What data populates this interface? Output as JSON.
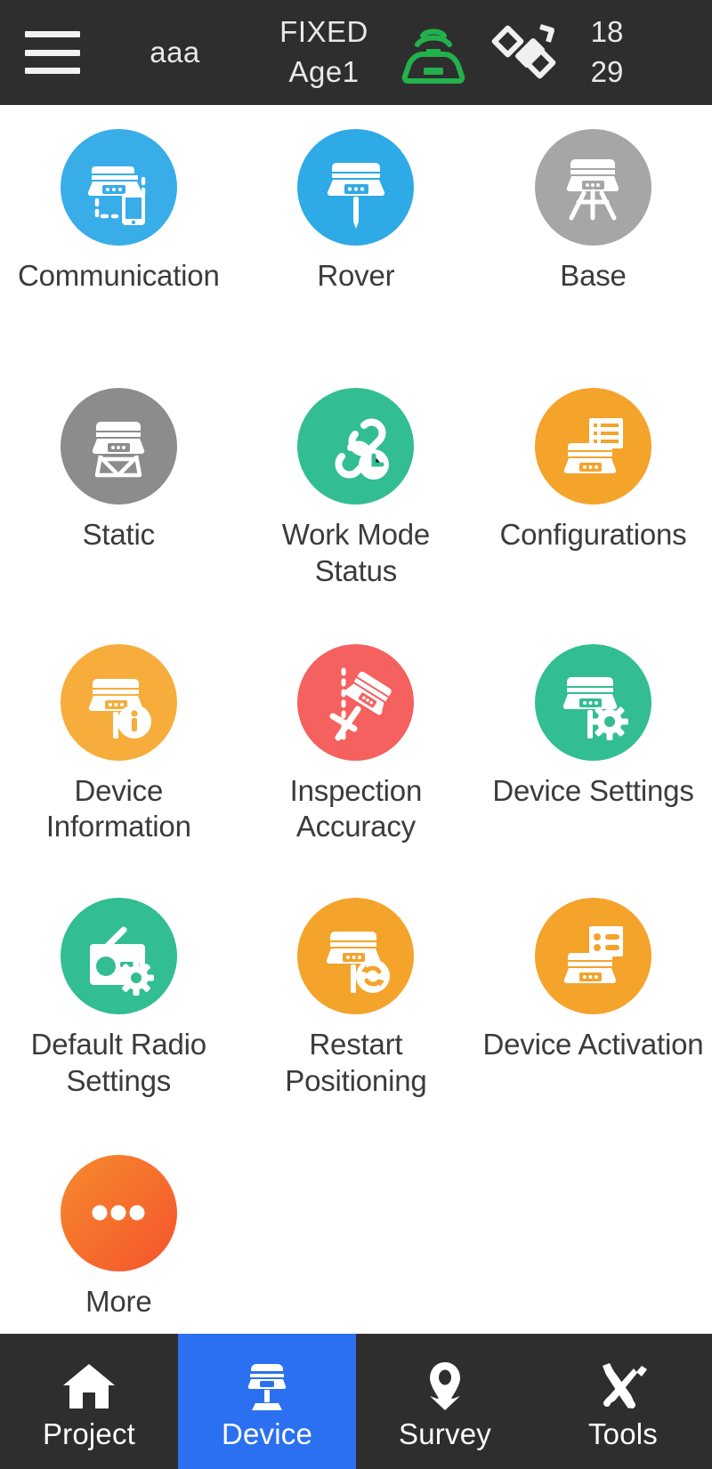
{
  "header": {
    "menu_icon": "hamburger-menu-icon",
    "project_name": "aaa",
    "fix_status": "FIXED",
    "age_status": "Age1",
    "radio_icon": "radio-receiver-signal-icon",
    "satellite_icon": "satellite-icon",
    "satellites_used": "18",
    "satellites_tracked": "29",
    "bar_color": "#2e2e2e",
    "radio_icon_color": "#22b14c"
  },
  "main": {
    "items": [
      {
        "label": "Communication",
        "icon": "receiver-to-phone-link-icon",
        "color": "#38ade8"
      },
      {
        "label": "Rover",
        "icon": "receiver-on-pole-icon",
        "color": "#2eaae6"
      },
      {
        "label": "Base",
        "icon": "receiver-on-tripod-icon",
        "color": "#a6a6a6"
      },
      {
        "label": "Static",
        "icon": "receiver-static-mount-icon",
        "color": "#8c8c8c"
      },
      {
        "label": "Work Mode Status",
        "icon": "link-clock-icon",
        "color": "#32bd93"
      },
      {
        "label": "Configurations",
        "icon": "receiver-list-icon",
        "color": "#f4a32b"
      },
      {
        "label": "Device Information",
        "icon": "receiver-info-icon",
        "color": "#f6ad3c"
      },
      {
        "label": "Inspection Accuracy",
        "icon": "tilted-pole-accuracy-icon",
        "color": "#f4615f"
      },
      {
        "label": "Device Settings",
        "icon": "receiver-gear-icon",
        "color": "#32bd93"
      },
      {
        "label": "Default Radio Settings",
        "icon": "radio-gear-icon",
        "color": "#32bd93"
      },
      {
        "label": "Restart Positioning",
        "icon": "receiver-restart-icon",
        "color": "#f4a32b"
      },
      {
        "label": "Device Activation",
        "icon": "receiver-activation-card-icon",
        "color": "#f4a32b"
      },
      {
        "label": "More",
        "icon": "ellipsis-icon",
        "color": "#f4672b"
      }
    ]
  },
  "navbar": {
    "active_index": 1,
    "active_color": "#2b70f0",
    "items": [
      {
        "label": "Project",
        "icon": "home-icon"
      },
      {
        "label": "Device",
        "icon": "receiver-device-icon"
      },
      {
        "label": "Survey",
        "icon": "map-pin-icon"
      },
      {
        "label": "Tools",
        "icon": "wrench-screwdriver-icon"
      }
    ]
  }
}
